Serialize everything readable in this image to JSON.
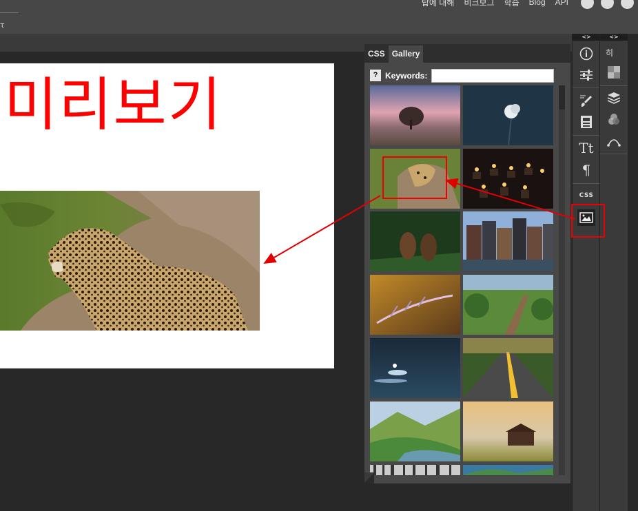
{
  "top_nav": {
    "items": [
      "탑에 대해",
      "비크보그",
      "학습",
      "Blog",
      "API"
    ],
    "tab_text": "τ"
  },
  "preview": {
    "title": "미리보기",
    "image_alt": "leopard-photo"
  },
  "panel": {
    "tabs": [
      "CSS",
      "Gallery"
    ],
    "active_tab": "Gallery",
    "help_button": "?",
    "keywords_label": "Keywords:",
    "keywords_value": "",
    "thumbnails": [
      "tree-sunset",
      "white-flower",
      "leopard",
      "candles",
      "pinecones",
      "amsterdam-houses",
      "feather",
      "garden-path",
      "water-bokeh",
      "yellow-road",
      "green-valley",
      "cabin-fog",
      "forest-bw",
      "coast"
    ]
  },
  "toolbars": {
    "collapse_label": "<>",
    "tool1": [
      "info-icon",
      "sliders-icon",
      "brush-icon",
      "layout-icon",
      "text-icon",
      "paragraph-icon",
      "css-label",
      "image-icon"
    ],
    "css_label": "CSS",
    "tool2_label": "히",
    "tool2": [
      "pattern-icon",
      "layers-icon",
      "blend-icon",
      "curve-icon"
    ]
  },
  "annotation": {
    "color": "#e00000"
  }
}
